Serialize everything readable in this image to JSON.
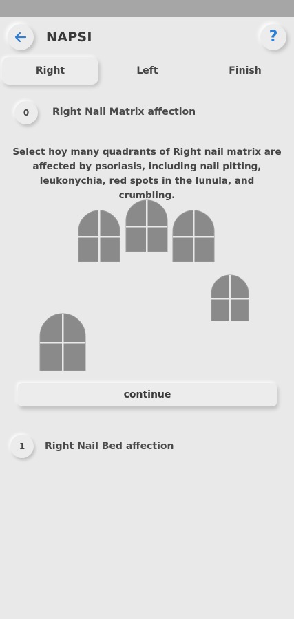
{
  "app": {
    "title": "NAPSI",
    "help_label": "?"
  },
  "tabs": [
    {
      "label": "Right",
      "active": true
    },
    {
      "label": "Left",
      "active": false
    },
    {
      "label": "Finish",
      "active": false
    }
  ],
  "steps": [
    {
      "number": "0",
      "title": "Right Nail Matrix affection"
    },
    {
      "number": "1",
      "title": "Right Nail Bed affection"
    }
  ],
  "instructions": "Select hoy many quadrants of Right nail matrix are affected by psoriasis, including nail pitting, leukonychia, red spots in the lunula, and crumbling.",
  "continue_label": "continue",
  "colors": {
    "accent": "#2b7fd6",
    "background": "#e9e9e9",
    "statusbar": "#a6a6a6",
    "nail_fill": "#8a8a8a"
  }
}
